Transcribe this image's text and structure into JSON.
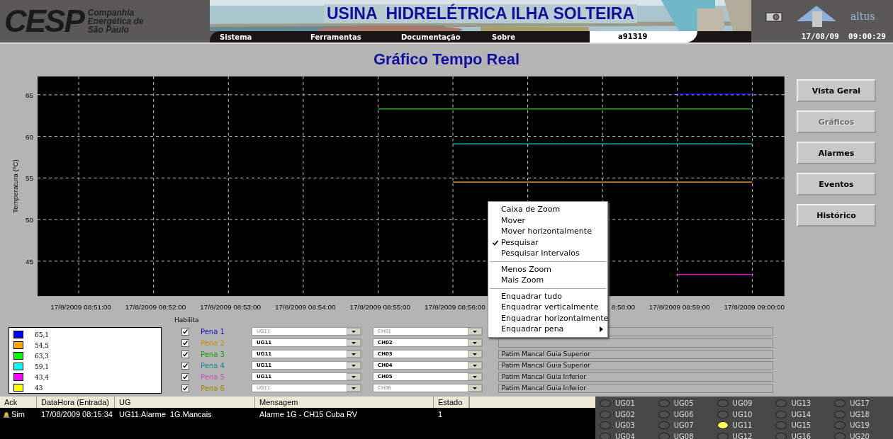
{
  "header": {
    "logo": "CESP",
    "company_lines": [
      "Companhia",
      "Energética de",
      "São Paulo"
    ],
    "title": "USINA  HIDRELÉTRICA ILHA SOLTEIRA",
    "nav": [
      "Sistema",
      "Ferramentas",
      "Documentação",
      "Sobre"
    ],
    "user": "a91319",
    "brand": "altus",
    "datetime": "17/08/09  09:00:29"
  },
  "page_title": "Gráfico Tempo Real",
  "chart": {
    "covered_tick_text": "8:58:00",
    "chart_data": {
      "type": "line",
      "ylabel": "Temperatura (ºC)",
      "categories": [
        "17/8/2009 08:51:00",
        "17/8/2009 08:52:00",
        "17/8/2009 08:53:00",
        "17/8/2009 08:54:00",
        "17/8/2009 08:55:00",
        "17/8/2009 08:56:00",
        null,
        null,
        "17/8/2009 08:59:00",
        "17/8/2009 09:00:00"
      ],
      "ylim": [
        40.8,
        67.2
      ],
      "grid": true,
      "yticks": [
        45,
        50,
        55,
        60,
        65
      ],
      "series": [
        {
          "color": "#0000ff",
          "values": [
            null,
            null,
            null,
            null,
            null,
            null,
            null,
            null,
            65.1,
            65.1
          ]
        },
        {
          "color": "#ffb040",
          "values": [
            null,
            null,
            null,
            null,
            null,
            54.5,
            54.5,
            54.5,
            54.5,
            54.5
          ]
        },
        {
          "color": "#20d020",
          "values": [
            null,
            null,
            null,
            null,
            63.3,
            63.3,
            63.3,
            63.3,
            63.3,
            63.3
          ]
        },
        {
          "color": "#20e0e0",
          "values": [
            null,
            null,
            null,
            null,
            null,
            59.1,
            59.1,
            59.1,
            59.1,
            59.1
          ]
        },
        {
          "color": "#ff00ff",
          "values": [
            null,
            null,
            null,
            null,
            null,
            null,
            null,
            null,
            43.4,
            43.4
          ]
        }
      ]
    }
  },
  "menu": {
    "groups": [
      [
        {
          "label": "Caixa de Zoom",
          "checked": false,
          "submenu": false
        },
        {
          "label": "Mover",
          "checked": false,
          "submenu": false
        },
        {
          "label": "Mover horizontalmente",
          "checked": false,
          "submenu": false
        },
        {
          "label": "Pesquisar",
          "checked": true,
          "submenu": false
        },
        {
          "label": "Pesquisar Intervalos",
          "checked": false,
          "submenu": false
        }
      ],
      [
        {
          "label": "Menos Zoom",
          "checked": false,
          "submenu": false
        },
        {
          "label": "Mais Zoom",
          "checked": false,
          "submenu": false
        }
      ],
      [
        {
          "label": "Enquadrar tudo",
          "checked": false,
          "submenu": false
        },
        {
          "label": "Enquadrar verticalmente",
          "checked": false,
          "submenu": false
        },
        {
          "label": "Enquadrar horizontalmente",
          "checked": false,
          "submenu": false
        },
        {
          "label": "Enquadrar pena",
          "checked": false,
          "submenu": true
        }
      ]
    ]
  },
  "nav_buttons": [
    {
      "label": "Vista Geral",
      "disabled": false
    },
    {
      "label": "Gráficos",
      "disabled": true
    },
    {
      "label": "Alarmes",
      "disabled": false
    },
    {
      "label": "Eventos",
      "disabled": false
    },
    {
      "label": "Histórico",
      "disabled": false
    }
  ],
  "legend": [
    {
      "color": "#0000ff",
      "value": "65,1"
    },
    {
      "color": "#ffa500",
      "value": "54,5"
    },
    {
      "color": "#00ff00",
      "value": "63,3"
    },
    {
      "color": "#00ffff",
      "value": "59,1"
    },
    {
      "color": "#ff00ff",
      "value": "43,4"
    },
    {
      "color": "#ffff00",
      "value": "43"
    }
  ],
  "habilita_label": "Habilita",
  "pens": [
    {
      "label": "Pena 1",
      "color": "#1010b0",
      "checked": true,
      "unit": "UG11",
      "channel": "CH01",
      "disabled": true
    },
    {
      "label": "Pena 2",
      "color": "#c89000",
      "checked": true,
      "unit": "UG11",
      "channel": "CH02",
      "disabled": false
    },
    {
      "label": "Pena 3",
      "color": "#10a010",
      "checked": true,
      "unit": "UG11",
      "channel": "CH03",
      "disabled": false,
      "description": "Patim Mancal Guia Superior"
    },
    {
      "label": "Pena 4",
      "color": "#0e8a92",
      "checked": true,
      "unit": "UG11",
      "channel": "CH04",
      "disabled": false,
      "description": "Patim Mancal Guia Superior"
    },
    {
      "label": "Pena 5",
      "color": "#c050c0",
      "checked": true,
      "unit": "UG11",
      "channel": "CH05",
      "disabled": false,
      "description": "Patim Mancal Guia Inferior"
    },
    {
      "label": "Pena 6",
      "color": "#9a8a00",
      "checked": true,
      "unit": "UG11",
      "channel": "CH06",
      "disabled": true,
      "description": "Patim Mancal Guia Inferior"
    }
  ],
  "alarms": {
    "columns": [
      "Ack",
      "DataHora (Entrada)",
      "UG",
      "Mensagem",
      "Estado"
    ],
    "rows": [
      {
        "ack": "Sim",
        "datetime": "17/08/2009 08:15:34",
        "ug": "UG11.Alarme  1G.Mancais",
        "message": "Alarme 1G - CH15 Cuba RV",
        "state": "1"
      }
    ]
  },
  "units": [
    {
      "label": "UG01",
      "on": false
    },
    {
      "label": "UG02",
      "on": false
    },
    {
      "label": "UG03",
      "on": false
    },
    {
      "label": "UG04",
      "on": false
    },
    {
      "label": "UG05",
      "on": false
    },
    {
      "label": "UG06",
      "on": false
    },
    {
      "label": "UG07",
      "on": false
    },
    {
      "label": "UG08",
      "on": false
    },
    {
      "label": "UG09",
      "on": false
    },
    {
      "label": "UG10",
      "on": false
    },
    {
      "label": "UG11",
      "on": true
    },
    {
      "label": "UG12",
      "on": false
    },
    {
      "label": "UG13",
      "on": false
    },
    {
      "label": "UG14",
      "on": false
    },
    {
      "label": "UG15",
      "on": false
    },
    {
      "label": "UG16",
      "on": false
    },
    {
      "label": "UG17",
      "on": false
    },
    {
      "label": "UG18",
      "on": false
    },
    {
      "label": "UG19",
      "on": false
    },
    {
      "label": "UG20",
      "on": false
    }
  ]
}
